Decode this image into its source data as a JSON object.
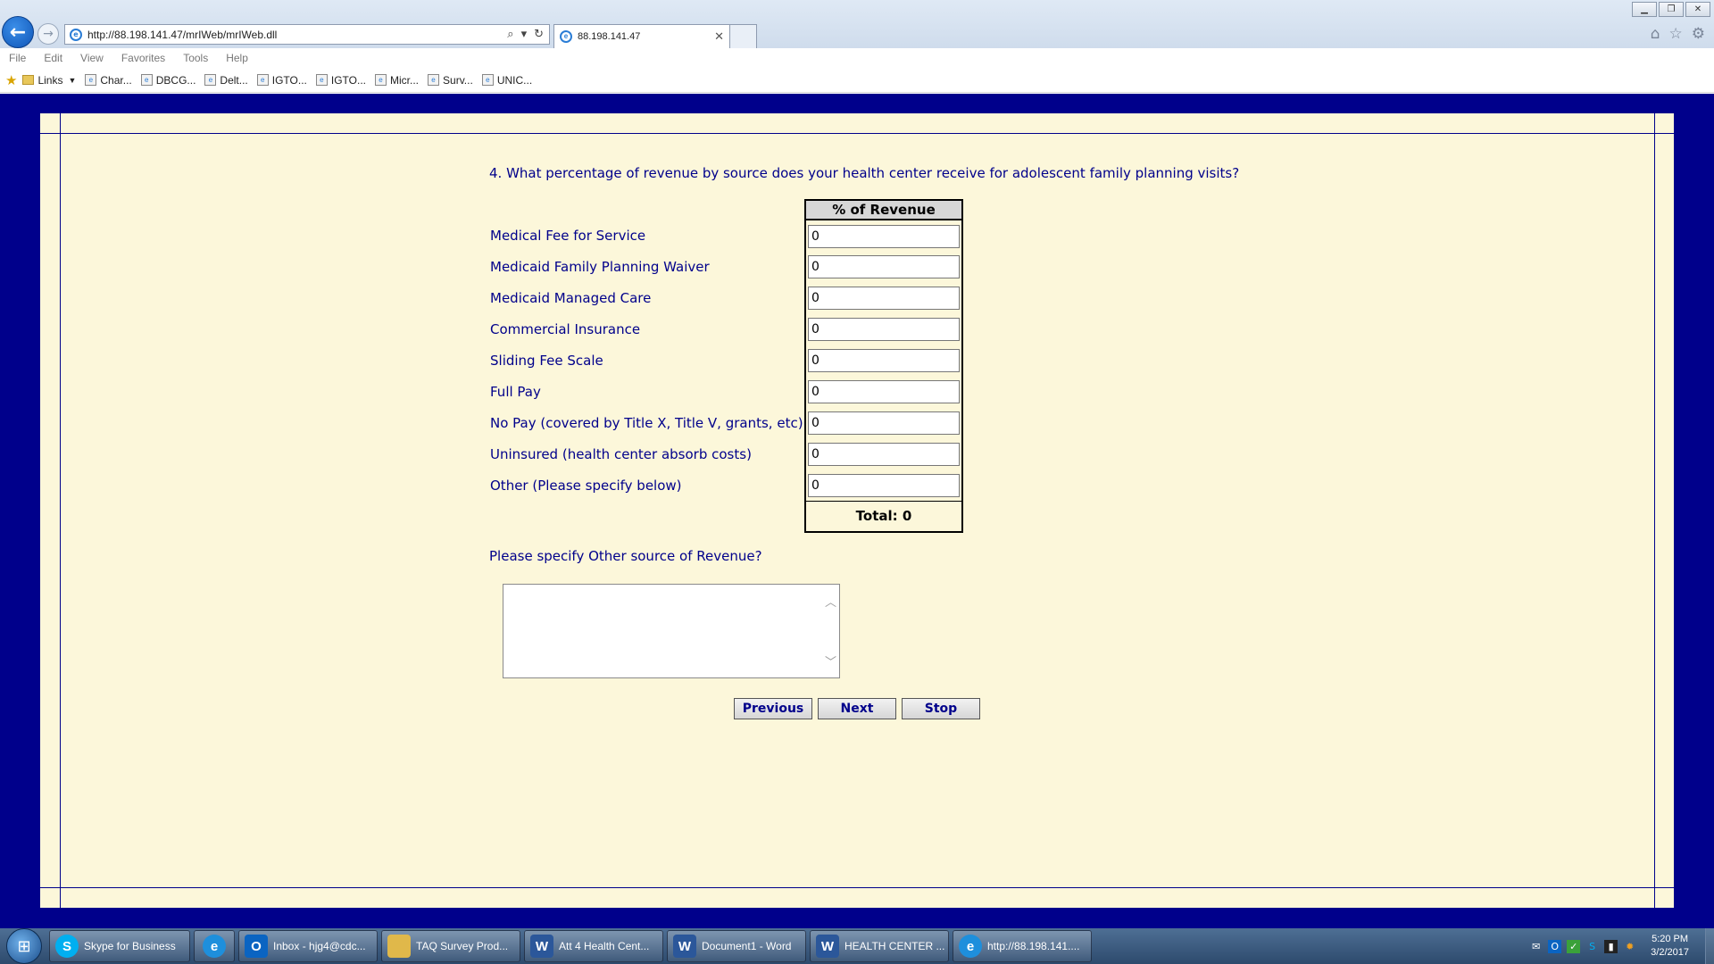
{
  "browser": {
    "url": "http://88.198.141.47/mrIWeb/mrIWeb.dll",
    "tab_title": "88.198.141.47",
    "menu": [
      "File",
      "Edit",
      "View",
      "Favorites",
      "Tools",
      "Help"
    ],
    "favorites": [
      {
        "label": "Links",
        "icon": "folder-icon"
      },
      {
        "label": "Char...",
        "icon": "page-icon"
      },
      {
        "label": "DBCG...",
        "icon": "page-icon"
      },
      {
        "label": "Delt...",
        "icon": "page-icon"
      },
      {
        "label": "IGTO...",
        "icon": "page-icon"
      },
      {
        "label": "IGTO...",
        "icon": "page-icon"
      },
      {
        "label": "Micr...",
        "icon": "page-icon"
      },
      {
        "label": "Surv...",
        "icon": "page-icon"
      },
      {
        "label": "UNIC...",
        "icon": "page-icon"
      }
    ]
  },
  "survey": {
    "question": "4. What percentage of revenue by source does your health center receive for adolescent family planning visits?",
    "column_header": "% of Revenue",
    "rows": [
      {
        "label": "Medical Fee for Service",
        "value": "0"
      },
      {
        "label": "Medicaid Family Planning Waiver",
        "value": "0"
      },
      {
        "label": "Medicaid Managed Care",
        "value": "0"
      },
      {
        "label": "Commercial Insurance",
        "value": "0"
      },
      {
        "label": "Sliding Fee Scale",
        "value": "0"
      },
      {
        "label": "Full Pay",
        "value": "0"
      },
      {
        "label": "No Pay (covered by Title X, Title V, grants, etc)",
        "value": "0"
      },
      {
        "label": "Uninsured (health center absorb costs)",
        "value": "0"
      },
      {
        "label": "Other (Please specify below)",
        "value": "0"
      }
    ],
    "total_label": "Total: 0",
    "specify_label": "Please specify Other source of Revenue?",
    "specify_value": "",
    "buttons": {
      "previous": "Previous",
      "next": "Next",
      "stop": "Stop"
    }
  },
  "taskbar": {
    "items": [
      {
        "label": "Skype for Business",
        "icon": "skype-icon",
        "color": "#00aff0"
      },
      {
        "label": "",
        "icon": "ie-icon",
        "color": "#1e8fdc"
      },
      {
        "label": "Inbox - hjg4@cdc...",
        "icon": "outlook-icon",
        "color": "#0a64c2"
      },
      {
        "label": "TAQ Survey Prod...",
        "icon": "folder-icon",
        "color": "#e0b84a"
      },
      {
        "label": "Att 4 Health Cent...",
        "icon": "word-icon",
        "color": "#2b579a"
      },
      {
        "label": "Document1 - Word",
        "icon": "word-icon",
        "color": "#2b579a"
      },
      {
        "label": "HEALTH CENTER ...",
        "icon": "word-icon",
        "color": "#2b579a"
      },
      {
        "label": "http://88.198.141....",
        "icon": "ie-icon",
        "color": "#1e8fdc"
      }
    ],
    "time": "5:20 PM",
    "date": "3/2/2017"
  },
  "colors": {
    "page_border": "#00008b",
    "panel_background": "#fcf7da",
    "text_navy": "#00008b"
  }
}
